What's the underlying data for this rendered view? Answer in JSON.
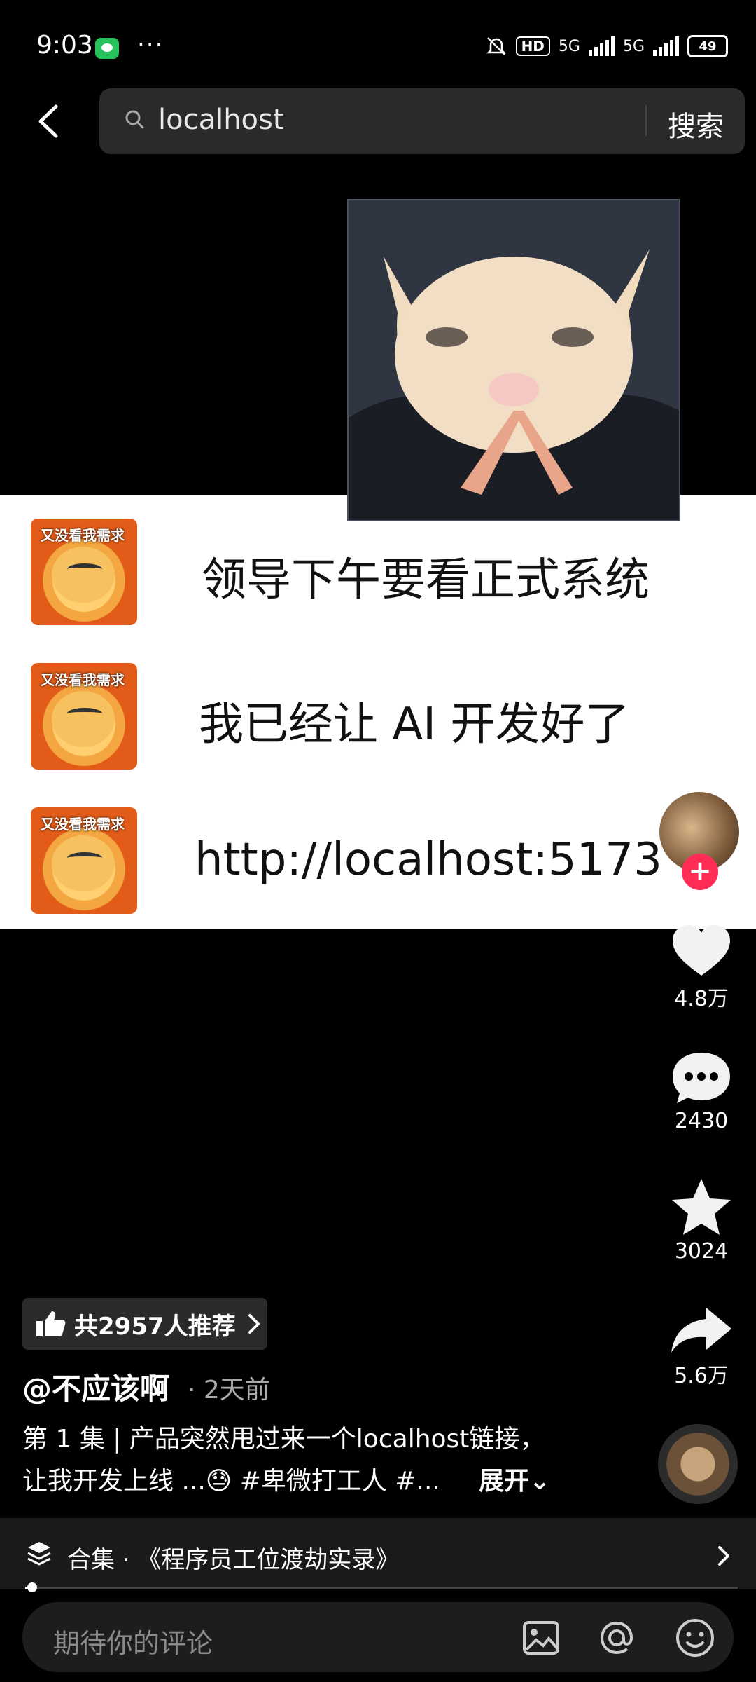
{
  "status_bar": {
    "time": "9:03",
    "more": "···",
    "hd_badge": "HD",
    "network1": "5G",
    "network2": "5G",
    "battery": "49"
  },
  "search": {
    "query": "localhost",
    "button": "搜索"
  },
  "chat": [
    {
      "avatar_label": "又没看我需求",
      "text": "领导下午要看正式系统"
    },
    {
      "avatar_label": "又没看我需求",
      "text": "我已经让 AI 开发好了"
    },
    {
      "avatar_label": "又没看我需求",
      "text": "http://localhost:5173"
    }
  ],
  "actions": {
    "likes": "4.8万",
    "comments": "2430",
    "favorites": "3024",
    "shares": "5.6万"
  },
  "recommend": "共2957人推荐",
  "author": "@不应该啊",
  "post_time": "· 2天前",
  "description": {
    "line1": "第 1 集 | 产品突然甩过来一个localhost链接，",
    "line2": "让我开发上线 ...😓 #卑微打工人 #...",
    "expand": "展开⌄"
  },
  "collection": "合集 · 《程序员工位渡劫实录》",
  "comment_placeholder": "期待你的评论",
  "progress": 0.01,
  "colors": {
    "accent": "#ff2d55",
    "background": "#000000"
  }
}
